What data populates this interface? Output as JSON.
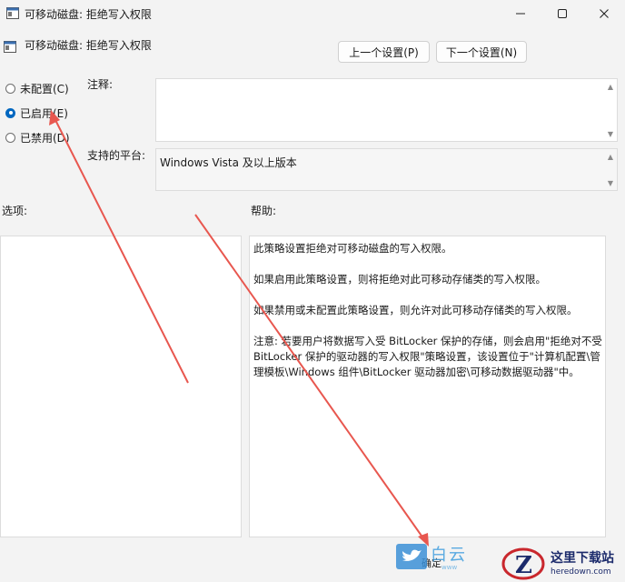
{
  "window": {
    "title": "可移动磁盘: 拒绝写入权限",
    "minimize_icon": "minimize-icon",
    "maximize_icon": "maximize-icon",
    "close_icon": "close-icon"
  },
  "header": {
    "title": "可移动磁盘: 拒绝写入权限",
    "prev_label": "上一个设置(P)",
    "next_label": "下一个设置(N)"
  },
  "state": {
    "options": [
      {
        "label": "未配置(C)",
        "selected": false
      },
      {
        "label": "已启用(E)",
        "selected": true
      },
      {
        "label": "已禁用(D)",
        "selected": false
      }
    ]
  },
  "comment": {
    "label": "注释:",
    "value": ""
  },
  "platform": {
    "label": "支持的平台:",
    "value": "Windows Vista 及以上版本"
  },
  "options_panel": {
    "label": "选项:"
  },
  "help_panel": {
    "label": "帮助:",
    "text": "此策略设置拒绝对可移动磁盘的写入权限。\n\n如果启用此策略设置，则将拒绝对此可移动存储类的写入权限。\n\n如果禁用或未配置此策略设置，则允许对此可移动存储类的写入权限。\n\n注意: 若要用户将数据写入受 BitLocker 保护的存储，则会启用\"拒绝对不受 BitLocker 保护的驱动器的写入权限\"策略设置，该设置位于\"计算机配置\\管理模板\\Windows 组件\\BitLocker 驱动器加密\\可移动数据驱动器\"中。"
  },
  "footer": {
    "ok_label": "确定"
  },
  "watermark": {
    "cn": "白云",
    "en": "www"
  },
  "logo": {
    "title": "这里下载站",
    "domain": "heredown.com"
  },
  "colors": {
    "accent": "#0067c0",
    "arrow": "#e8574f"
  }
}
